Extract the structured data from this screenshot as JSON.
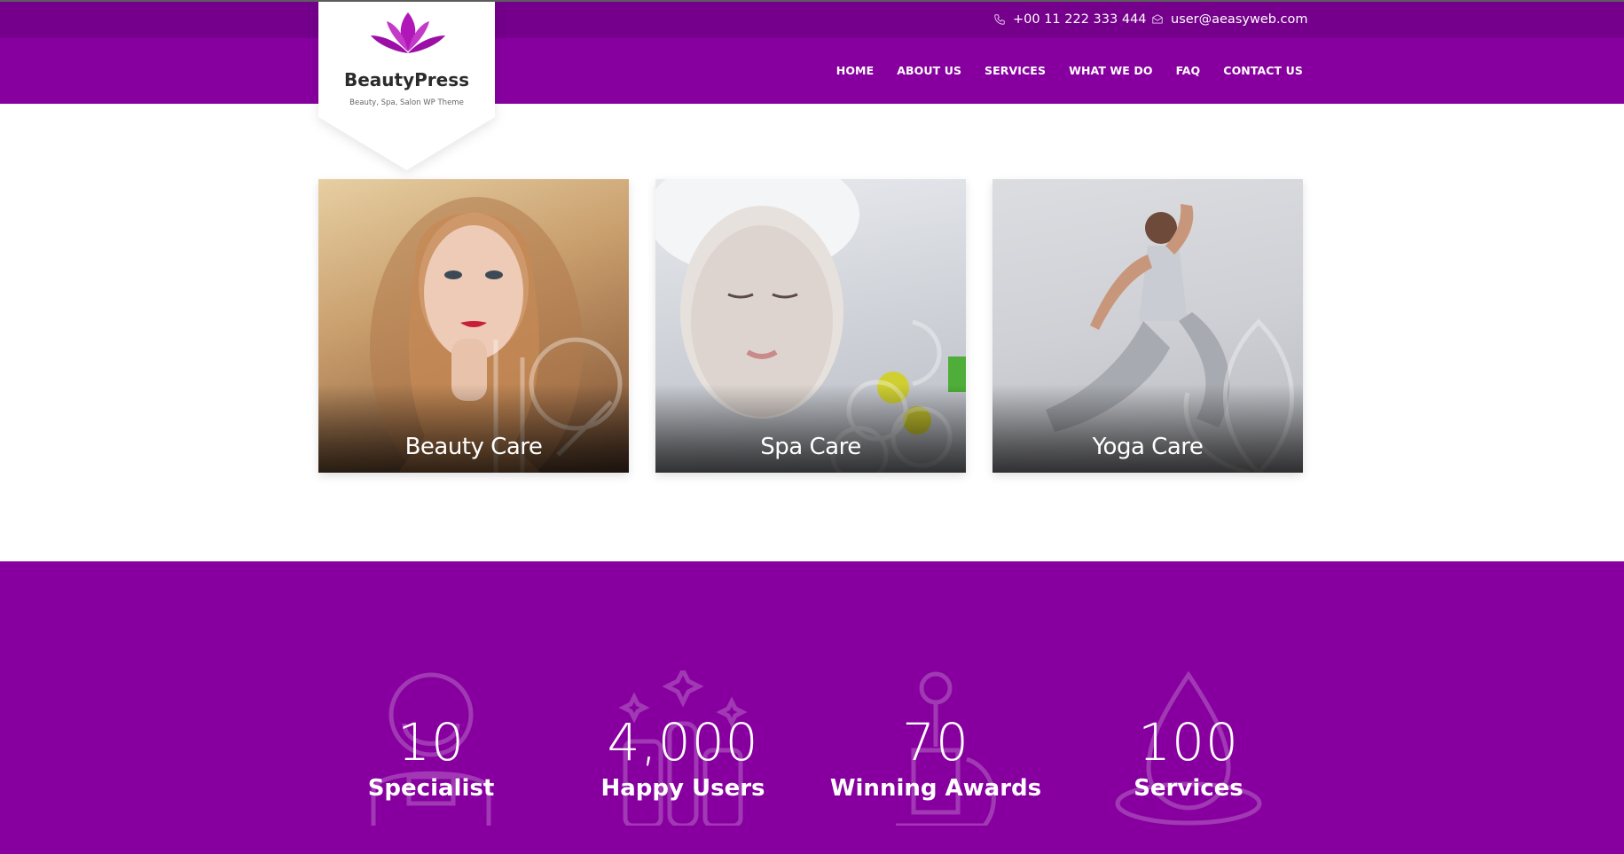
{
  "brand": {
    "name": "BeautyPress",
    "tagline": "Beauty, Spa, Salon WP Theme",
    "accent": "#87009f",
    "accent_dark": "#74008b",
    "logo_icon": "lotus-icon"
  },
  "topbar": {
    "phone": "+00 11 222 333 444",
    "phone_icon": "phone-icon",
    "email": "user@aeasyweb.com",
    "email_icon": "envelope-icon"
  },
  "menu": {
    "items": [
      "HOME",
      "ABOUT US",
      "SERVICES",
      "WHAT WE DO",
      "FAQ",
      "CONTACT US"
    ]
  },
  "cards": [
    {
      "label": "Beauty Care"
    },
    {
      "label": "Spa Care"
    },
    {
      "label": "Yoga Care"
    }
  ],
  "stats": [
    {
      "number": "10",
      "label": "Specialist",
      "icon": "specialist-icon"
    },
    {
      "number": "4,000",
      "label": "Happy Users",
      "icon": "cosmetics-icon"
    },
    {
      "number": "70",
      "label": "Winning Awards",
      "icon": "oil-bottle-icon"
    },
    {
      "number": "100",
      "label": "Services",
      "icon": "water-drop-icon"
    }
  ]
}
